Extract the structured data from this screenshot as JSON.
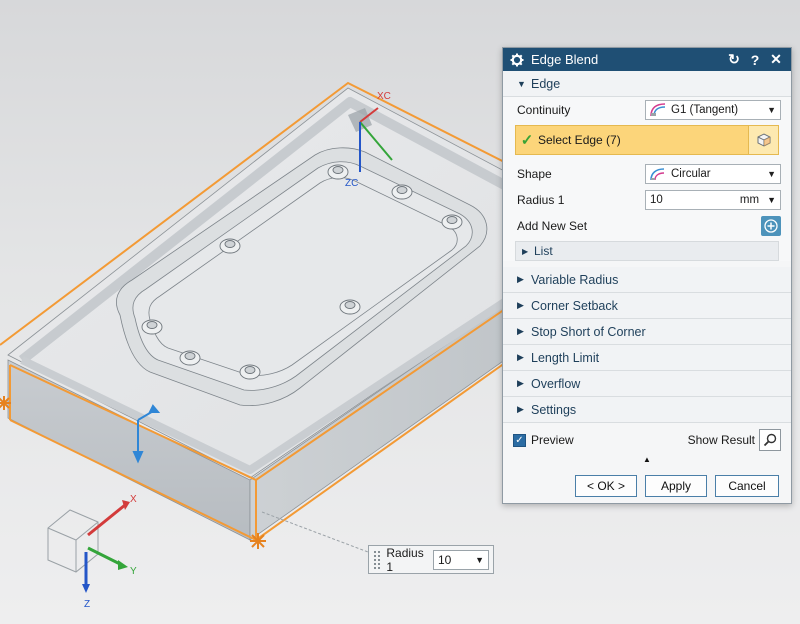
{
  "viewport": {
    "wcs_labels": {
      "xc": "XC",
      "zc": "ZC"
    },
    "triad_labels": {
      "x": "X",
      "y": "Y",
      "z": "Z"
    },
    "colors": {
      "selected_edge": "#f39a35",
      "model_face": "#e4e6e8",
      "x_axis": "#d33b3b",
      "y_axis": "#34a53a",
      "z_axis": "#2456c8"
    }
  },
  "dialog": {
    "title": "Edge Blend",
    "title_icon": "gear-icon",
    "reset_glyph": "↻",
    "help_glyph": "?",
    "close_glyph": "✕",
    "edge_section": {
      "title": "Edge",
      "continuity_label": "Continuity",
      "continuity_value": "G1 (Tangent)",
      "select_edge_label": "Select Edge (7)",
      "shape_label": "Shape",
      "shape_value": "Circular",
      "radius_label": "Radius 1",
      "radius_value": "10",
      "radius_unit": "mm",
      "add_new_set_label": "Add New Set",
      "list_label": "List"
    },
    "collapsed_sections": [
      "Variable Radius",
      "Corner Setback",
      "Stop Short of Corner",
      "Length Limit",
      "Overflow",
      "Settings"
    ],
    "preview_label": "Preview",
    "preview_checked": true,
    "show_result_label": "Show Result",
    "ok_label": "< OK >",
    "apply_label": "Apply",
    "cancel_label": "Cancel",
    "accent_color": "#1f4f74",
    "highlight_color": "#fcd57a"
  },
  "radius_popup": {
    "label": "Radius 1",
    "value": "10"
  }
}
